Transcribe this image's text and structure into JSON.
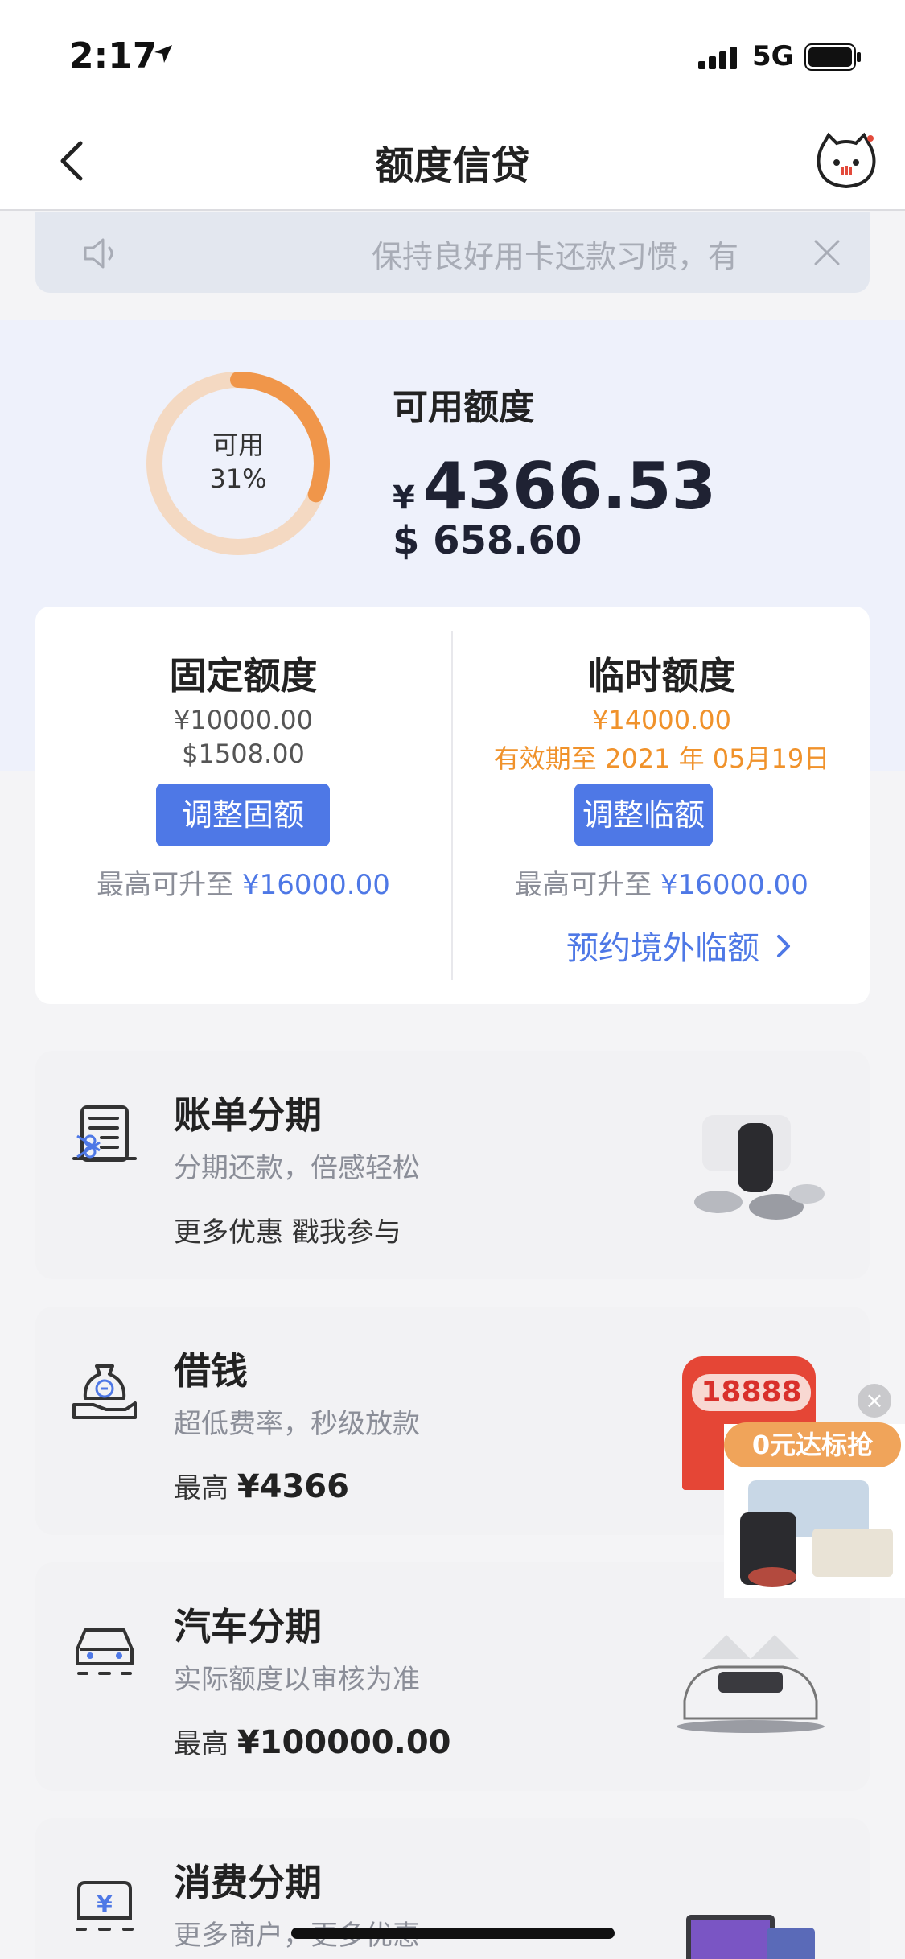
{
  "status_bar": {
    "time": "2:17",
    "network": "5G"
  },
  "nav": {
    "title": "额度信贷"
  },
  "notice": {
    "text": "保持良好用卡还款习惯，有"
  },
  "available": {
    "title": "可用额度",
    "ring_label": "可用",
    "ring_percent": "31%",
    "ring_fraction": 0.31,
    "cny_symbol": "¥",
    "cny_amount": "4366.53",
    "usd_amount": "$ 658.60"
  },
  "fixed": {
    "title": "固定额度",
    "cny": "¥10000.00",
    "usd": "$1508.00",
    "button": "调整固额",
    "max_prefix": "最高可升至",
    "max_value": "¥16000.00"
  },
  "temp": {
    "title": "临时额度",
    "cny": "¥14000.00",
    "validity": "有效期至 2021 年 05月19日",
    "button": "调整临额",
    "max_prefix": "最高可升至",
    "max_value": "¥16000.00",
    "overseas_link": "预约境外临额"
  },
  "cards": [
    {
      "title": "账单分期",
      "subtitle": "分期还款，倍感轻松",
      "foot": "更多优惠 戳我参与",
      "icon": "bill-icon"
    },
    {
      "title": "借钱",
      "subtitle": "超低费率，秒级放款",
      "foot_prefix": "最高",
      "foot_value": "¥4366",
      "icon": "money-bag-hand-icon"
    },
    {
      "title": "汽车分期",
      "subtitle": "实际额度以审核为准",
      "foot_prefix": "最高",
      "foot_value": "¥100000.00",
      "icon": "car-icon"
    },
    {
      "title": "消费分期",
      "subtitle": "更多商户，更多优惠",
      "icon": "yuan-bag-icon"
    }
  ],
  "promo": {
    "badge": "18888",
    "pill": "0元达标抢"
  },
  "colors": {
    "accent": "#4e78e6",
    "orange": "#f0922b",
    "ring_bg": "#f4d9c2",
    "ring_fg": "#f0964a"
  }
}
